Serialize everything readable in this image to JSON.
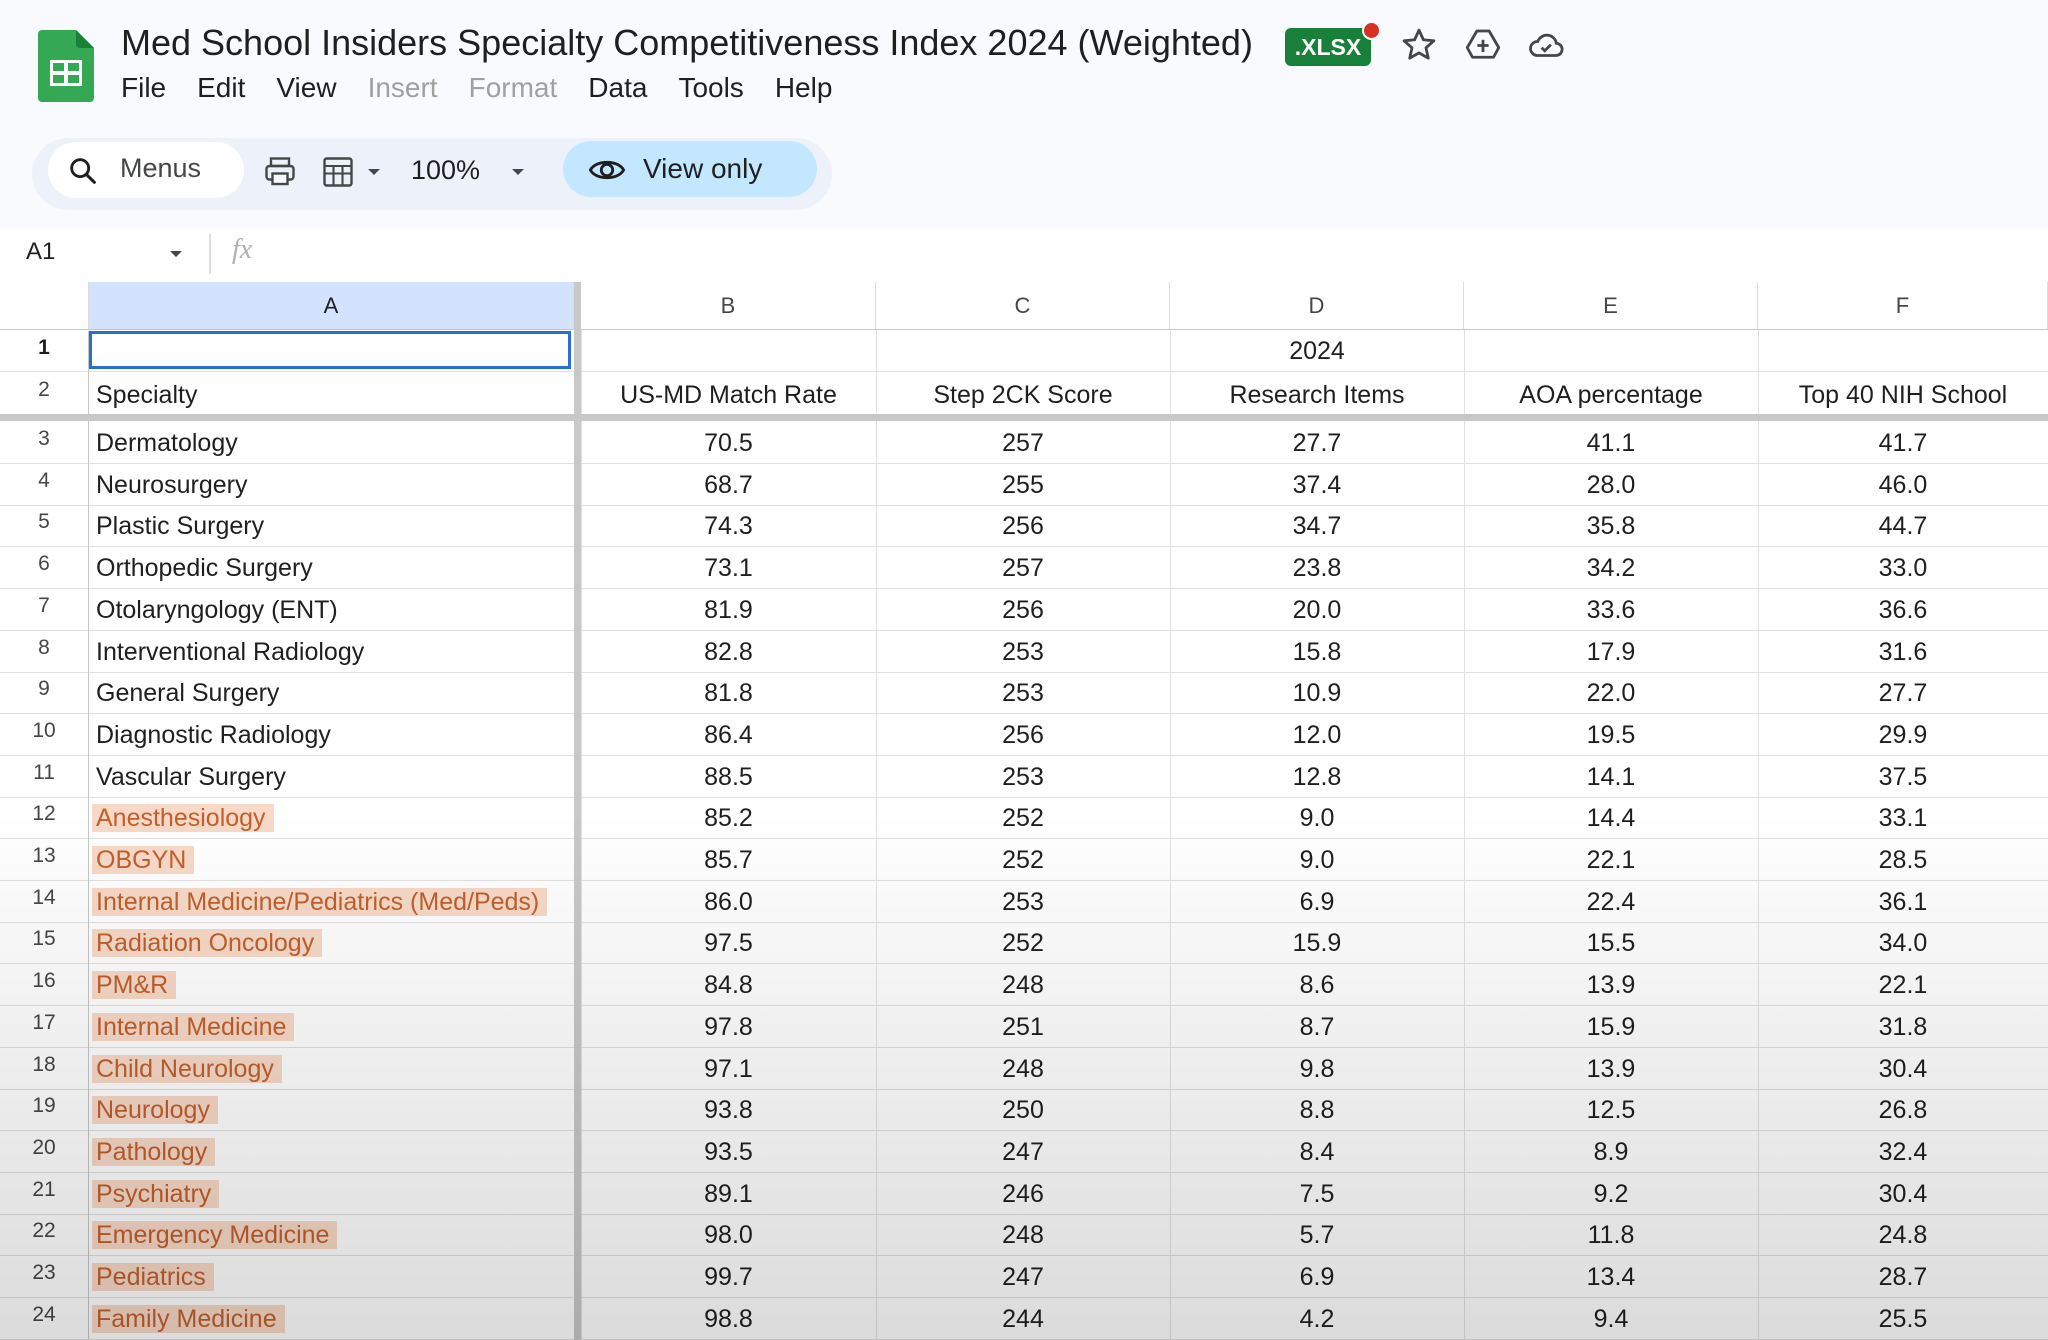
{
  "app": {
    "title": "Med School Insiders Specialty Competitiveness Index 2024 (Weighted)",
    "file_badge": ".XLSX",
    "icons": [
      "sheets-logo-icon",
      "star-icon",
      "move-to-drive-icon",
      "cloud-status-icon"
    ],
    "brand_color": "#188038"
  },
  "menu": [
    "File",
    "Edit",
    "View",
    "Insert",
    "Format",
    "Data",
    "Tools",
    "Help"
  ],
  "toolbar": {
    "search_label": "Menus",
    "zoom": "100%",
    "view_only_label": "View only",
    "icons": [
      "search-icon",
      "print-icon",
      "format-icon",
      "eye-icon"
    ]
  },
  "formula_bar": {
    "name_box": "A1",
    "fx_label": "fx"
  },
  "sheet": {
    "columns": [
      "A",
      "B",
      "C",
      "D",
      "E",
      "F"
    ],
    "year_label": "2024",
    "headers": [
      "Specialty",
      "US-MD Match Rate",
      "Step 2CK Score",
      "Research Items",
      "AOA percentage",
      "Top 40 NIH School"
    ],
    "rows": [
      {
        "n": "3",
        "specialty": "Dermatology",
        "b": "70.5",
        "c": "257",
        "d": "27.7",
        "e": "41.1",
        "f": "41.7",
        "hl": false
      },
      {
        "n": "4",
        "specialty": "Neurosurgery",
        "b": "68.7",
        "c": "255",
        "d": "37.4",
        "e": "28.0",
        "f": "46.0",
        "hl": false
      },
      {
        "n": "5",
        "specialty": "Plastic Surgery",
        "b": "74.3",
        "c": "256",
        "d": "34.7",
        "e": "35.8",
        "f": "44.7",
        "hl": false
      },
      {
        "n": "6",
        "specialty": "Orthopedic Surgery",
        "b": "73.1",
        "c": "257",
        "d": "23.8",
        "e": "34.2",
        "f": "33.0",
        "hl": false
      },
      {
        "n": "7",
        "specialty": "Otolaryngology (ENT)",
        "b": "81.9",
        "c": "256",
        "d": "20.0",
        "e": "33.6",
        "f": "36.6",
        "hl": false
      },
      {
        "n": "8",
        "specialty": "Interventional Radiology",
        "b": "82.8",
        "c": "253",
        "d": "15.8",
        "e": "17.9",
        "f": "31.6",
        "hl": false
      },
      {
        "n": "9",
        "specialty": "General Surgery",
        "b": "81.8",
        "c": "253",
        "d": "10.9",
        "e": "22.0",
        "f": "27.7",
        "hl": false
      },
      {
        "n": "10",
        "specialty": "Diagnostic Radiology",
        "b": "86.4",
        "c": "256",
        "d": "12.0",
        "e": "19.5",
        "f": "29.9",
        "hl": false
      },
      {
        "n": "11",
        "specialty": "Vascular Surgery",
        "b": "88.5",
        "c": "253",
        "d": "12.8",
        "e": "14.1",
        "f": "37.5",
        "hl": false
      },
      {
        "n": "12",
        "specialty": "Anesthesiology",
        "b": "85.2",
        "c": "252",
        "d": "9.0",
        "e": "14.4",
        "f": "33.1",
        "hl": true
      },
      {
        "n": "13",
        "specialty": "OBGYN",
        "b": "85.7",
        "c": "252",
        "d": "9.0",
        "e": "22.1",
        "f": "28.5",
        "hl": true
      },
      {
        "n": "14",
        "specialty": "Internal Medicine/Pediatrics (Med/Peds)",
        "b": "86.0",
        "c": "253",
        "d": "6.9",
        "e": "22.4",
        "f": "36.1",
        "hl": true
      },
      {
        "n": "15",
        "specialty": "Radiation Oncology",
        "b": "97.5",
        "c": "252",
        "d": "15.9",
        "e": "15.5",
        "f": "34.0",
        "hl": true
      },
      {
        "n": "16",
        "specialty": "PM&R",
        "b": "84.8",
        "c": "248",
        "d": "8.6",
        "e": "13.9",
        "f": "22.1",
        "hl": true
      },
      {
        "n": "17",
        "specialty": "Internal Medicine",
        "b": "97.8",
        "c": "251",
        "d": "8.7",
        "e": "15.9",
        "f": "31.8",
        "hl": true
      },
      {
        "n": "18",
        "specialty": "Child Neurology",
        "b": "97.1",
        "c": "248",
        "d": "9.8",
        "e": "13.9",
        "f": "30.4",
        "hl": true
      },
      {
        "n": "19",
        "specialty": "Neurology",
        "b": "93.8",
        "c": "250",
        "d": "8.8",
        "e": "12.5",
        "f": "26.8",
        "hl": true
      },
      {
        "n": "20",
        "specialty": "Pathology",
        "b": "93.5",
        "c": "247",
        "d": "8.4",
        "e": "8.9",
        "f": "32.4",
        "hl": true
      },
      {
        "n": "21",
        "specialty": "Psychiatry",
        "b": "89.1",
        "c": "246",
        "d": "7.5",
        "e": "9.2",
        "f": "30.4",
        "hl": true
      },
      {
        "n": "22",
        "specialty": "Emergency Medicine",
        "b": "98.0",
        "c": "248",
        "d": "5.7",
        "e": "11.8",
        "f": "24.8",
        "hl": true
      },
      {
        "n": "23",
        "specialty": "Pediatrics",
        "b": "99.7",
        "c": "247",
        "d": "6.9",
        "e": "13.4",
        "f": "28.7",
        "hl": true
      },
      {
        "n": "24",
        "specialty": "Family Medicine",
        "b": "98.8",
        "c": "244",
        "d": "4.2",
        "e": "9.4",
        "f": "25.5",
        "hl": true
      }
    ],
    "highlight_color": "#f8d9c7",
    "highlight_text_color": "#c0602d",
    "selection_color": "#2b6fd6"
  }
}
